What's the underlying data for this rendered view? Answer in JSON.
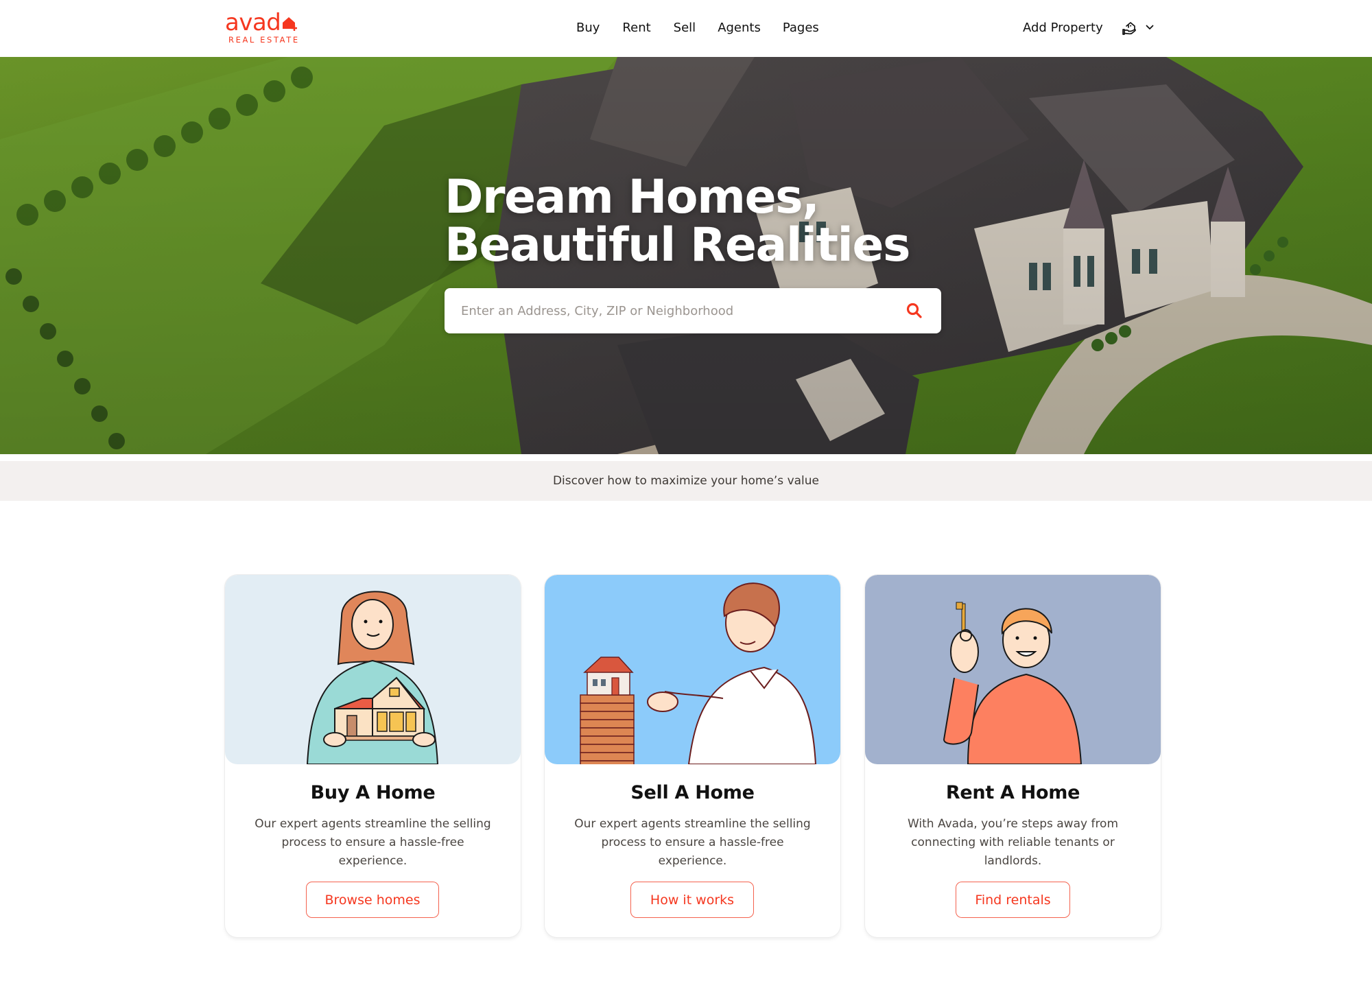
{
  "header": {
    "logo": {
      "word": "avad",
      "sub": "REAL ESTATE"
    },
    "nav": [
      {
        "label": "Buy"
      },
      {
        "label": "Rent"
      },
      {
        "label": "Sell"
      },
      {
        "label": "Agents"
      },
      {
        "label": "Pages"
      }
    ],
    "add_property_label": "Add Property",
    "account_icon": "house-hand-icon",
    "dropdown_icon": "chevron-down-icon"
  },
  "hero": {
    "title_line1": "Dream Homes,",
    "title_line2": "Beautiful Realities",
    "search": {
      "placeholder": "Enter an Address, City, ZIP or Neighborhood",
      "value": "",
      "icon": "search-icon"
    }
  },
  "banner": {
    "text": "Discover how to maximize your home’s value"
  },
  "cards": [
    {
      "title": "Buy A Home",
      "description": "Our expert agents streamline the selling process to ensure a hassle-free experience.",
      "button_label": "Browse homes",
      "image_bg": "#e2edf4"
    },
    {
      "title": "Sell A Home",
      "description": "Our expert agents streamline the selling process to ensure a hassle-free experience.",
      "button_label": "How it works",
      "image_bg": "#8ccbfa"
    },
    {
      "title": "Rent A Home",
      "description": "With Avada, you’re steps away from connecting with reliable tenants or landlords.",
      "button_label": "Find rentals",
      "image_bg": "#a2b1cd"
    }
  ],
  "colors": {
    "accent": "#f5371f",
    "banner_bg": "#f3f0ef",
    "text_dark": "#111111",
    "text_body": "#4a4541"
  }
}
